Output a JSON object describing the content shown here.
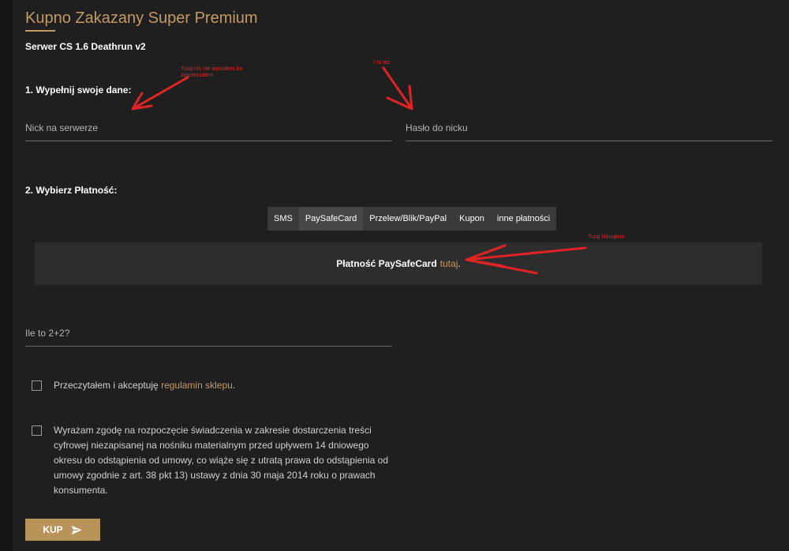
{
  "header": {
    "title": "Kupno Zakazany Super Premium",
    "server": "Serwer CS 1.6 Deathrun v2"
  },
  "step1": {
    "label": "1. Wypełnij swoje dane:",
    "nick_placeholder": "Nick na serwerze",
    "password_placeholder": "Hasło do nicku"
  },
  "step2": {
    "label": "2. Wybierz Płatność:",
    "tabs": [
      "SMS",
      "PaySafeCard",
      "Przelew/Blik/PayPal",
      "Kupon",
      "inne płatności"
    ],
    "active_tab": "PaySafeCard",
    "payment_text": "Płatność PaySafeCard",
    "payment_link": "tutaj",
    "payment_suffix": "."
  },
  "captcha": {
    "placeholder": "Ile to 2+2?"
  },
  "consents": {
    "terms_prefix": "Przeczytałem i akceptuję",
    "terms_link": "regulamin sklepu",
    "terms_suffix": ".",
    "withdrawal_text": "Wyrażam zgodę na rozpoczęcie świadczenia w zakresie dostarczenia treści cyfrowej niezapisanej na nośniku materialnym przed upływem 14 dniowego okresu do odstąpienia od umowy, co wiąże się z utratą prawa do odstąpienia od umowy zgodnie z art. 38 pkt 13) ustawy z dnia 30 maja 2014 roku o prawach konsumenta."
  },
  "buy_button": {
    "label": "KUP",
    "icon": "send-icon"
  },
  "annotations": {
    "note1": "Tutaj nic nie wpisałem bo zapomniałem",
    "note2": "i tu też",
    "note3": "Tutaj kliknąłem"
  },
  "colors": {
    "accent": "#c49a63",
    "button": "#b8935a",
    "annotation": "#e02424",
    "background": "#1f1f20"
  }
}
